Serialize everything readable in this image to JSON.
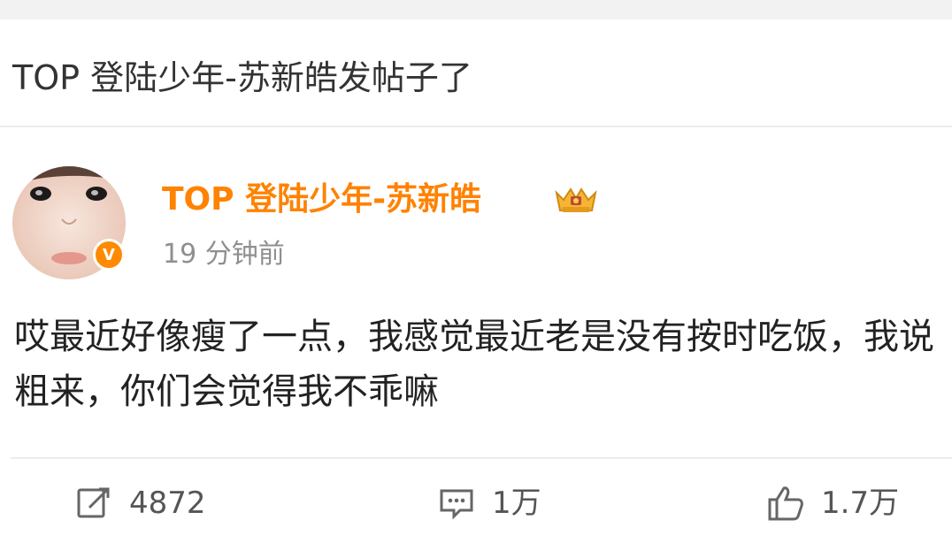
{
  "notification": {
    "title": "TOP 登陆少年-苏新皓发帖子了"
  },
  "post": {
    "author": {
      "name": "TOP 登陆少年-苏新皓",
      "verified_badge": "V",
      "crown_icon": "crown-badge-icon"
    },
    "timestamp": "19 分钟前",
    "text": "哎最近好像瘦了一点，我感觉最近老是没有按时吃饭，我说粗来，你们会觉得我不乖嘛"
  },
  "actions": {
    "repost": {
      "icon": "share-icon",
      "count": "4872"
    },
    "comment": {
      "icon": "comment-icon",
      "count": "1万"
    },
    "like": {
      "icon": "thumbs-up-icon",
      "count": "1.7万"
    }
  },
  "colors": {
    "username": "#ff8200",
    "verified_badge": "#ff8a00",
    "text": "#222222",
    "muted": "#8f8f8f"
  }
}
